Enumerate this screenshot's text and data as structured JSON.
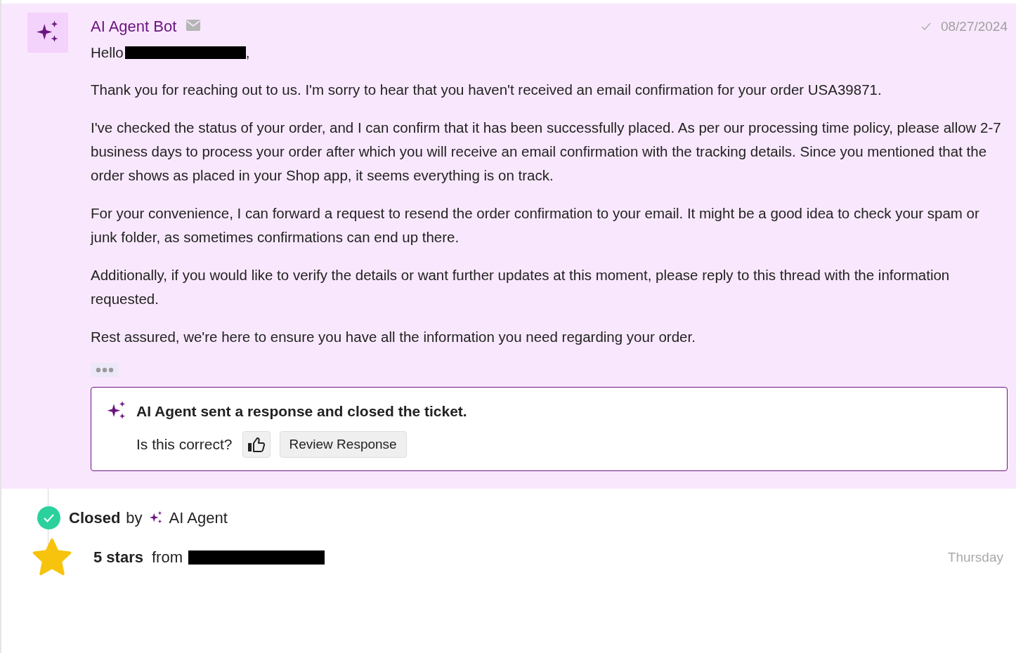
{
  "message": {
    "sender": "AI Agent Bot",
    "date": "08/27/2024",
    "delivered": true,
    "greeting": {
      "before": "Hello",
      "after": ","
    },
    "paragraphs": [
      "Thank you for reaching out to us. I'm sorry to hear that you haven't received an email confirmation for your order USA39871.",
      "I've checked the status of your order, and I can confirm that it has been successfully placed. As per our processing time policy, please allow 2-7 business days to process your order after which you will receive an email confirmation with the tracking details. Since you mentioned that the order shows as placed in your Shop app, it seems everything is on track.",
      "For your convenience, I can forward a request to resend the order confirmation to your email. It might be a good idea to check your spam or junk folder, as sometimes confirmations can end up there.",
      "Additionally, if you would like to verify the details or want further updates at this moment, please reply to this thread with the information requested.",
      "Rest assured, we're here to ensure you have all the information you need regarding your order."
    ]
  },
  "agent_notice": {
    "title": "AI Agent sent a response and closed the ticket.",
    "question": "Is this correct?",
    "button": "Review Response"
  },
  "events": [
    {
      "kind": "closed",
      "label": "Closed",
      "by": "by",
      "agent": "AI Agent"
    },
    {
      "kind": "rating",
      "label": "5 stars",
      "from": "from",
      "time": "Thursday"
    }
  ]
}
